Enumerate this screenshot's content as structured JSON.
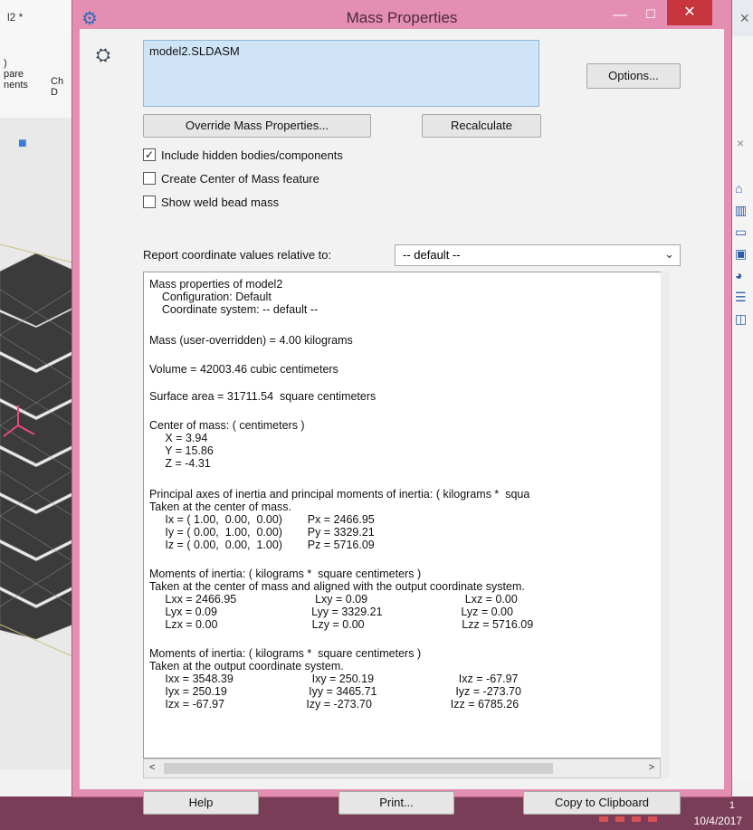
{
  "background": {
    "tab_title": "l2 *",
    "close_glyph": "×",
    "ribbon_labels": [
      ")\npare\nnents",
      "Ch\nD"
    ],
    "taskbar_date": "10/4/2017",
    "taskbar_badge": "1"
  },
  "dialog": {
    "title": "Mass Properties",
    "model_name": "model2.SLDASM",
    "options_label": "Options...",
    "override_label": "Override Mass Properties...",
    "recalculate_label": "Recalculate",
    "checkboxes": [
      {
        "label": "Include hidden bodies/components",
        "checked": true
      },
      {
        "label": "Create Center of Mass feature",
        "checked": false
      },
      {
        "label": "Show weld bead mass",
        "checked": false
      }
    ],
    "report_label": "Report coordinate values relative to:",
    "coordinate_selected": "-- default --",
    "results": {
      "lines": [
        "Mass properties of model2",
        "    Configuration: Default",
        "    Coordinate system: -- default --",
        "Mass (user-overridden) = 4.00 kilograms",
        "Volume = 42003.46 cubic centimeters",
        "Surface area = 31711.54  square centimeters",
        "Center of mass: ( centimeters )",
        "     X = 3.94",
        "     Y = 15.86",
        "     Z = -4.31",
        "Principal axes of inertia and principal moments of inertia: ( kilograms *  squa",
        "Taken at the center of mass.",
        "     Ix = ( 1.00,  0.00,  0.00)        Px = 2466.95",
        "     Iy = ( 0.00,  1.00,  0.00)        Py = 3329.21",
        "     Iz = ( 0.00,  0.00,  1.00)        Pz = 5716.09",
        "Moments of inertia: ( kilograms *  square centimeters )",
        "Taken at the center of mass and aligned with the output coordinate system.",
        "     Lxx = 2466.95                         Lxy = 0.09                               Lxz = 0.00",
        "     Lyx = 0.09                              Lyy = 3329.21                         Lyz = 0.00",
        "     Lzx = 0.00                              Lzy = 0.00                               Lzz = 5716.09",
        "Moments of inertia: ( kilograms *  square centimeters )",
        "Taken at the output coordinate system.",
        "     Ixx = 3548.39                         Ixy = 250.19                           Ixz = -67.97",
        "     Iyx = 250.19                          Iyy = 3465.71                         Iyz = -273.70",
        "     Izx = -67.97                          Izy = -273.70                         Izz = 6785.26"
      ]
    },
    "help_label": "Help",
    "print_label": "Print...",
    "copy_label": "Copy to Clipboard"
  }
}
